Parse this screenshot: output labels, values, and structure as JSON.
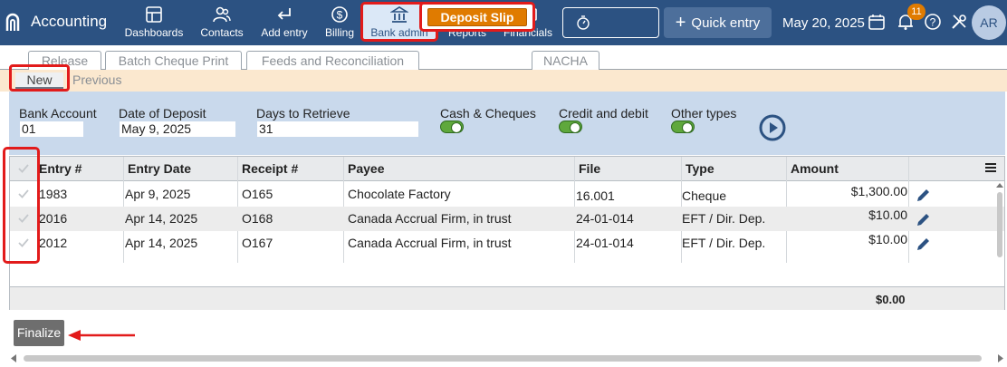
{
  "app": {
    "title": "Accounting"
  },
  "nav": [
    {
      "label": "Dashboards",
      "icon": "dashboard-icon"
    },
    {
      "label": "Contacts",
      "icon": "contacts-icon"
    },
    {
      "label": "Add entry",
      "icon": "return-arrow-icon"
    },
    {
      "label": "Billing",
      "icon": "dollar-icon"
    },
    {
      "label": "Bank admin",
      "icon": "bank-icon"
    },
    {
      "label": "Reports",
      "icon": "bar-chart-icon"
    },
    {
      "label": "Financials",
      "icon": "money-icon"
    }
  ],
  "header": {
    "quick_entry_label": "Quick entry",
    "date": "May 20, 2025",
    "notification_count": "11",
    "avatar_initials": "AR"
  },
  "tabs": [
    "Release",
    "Batch Cheque Print",
    "Feeds and Reconciliation",
    "Deposit Slip",
    "NACHA"
  ],
  "active_tab": "Deposit Slip",
  "subtabs": {
    "new": "New",
    "previous": "Previous"
  },
  "filters": {
    "bank_account_label": "Bank Account",
    "bank_account_value": "01",
    "deposit_date_label": "Date of Deposit",
    "deposit_date_value": "May 9, 2025",
    "days_label": "Days to Retrieve",
    "days_value": "31",
    "toggles": [
      {
        "label": "Cash & Cheques",
        "on": true
      },
      {
        "label": "Credit and debit",
        "on": true
      },
      {
        "label": "Other types",
        "on": true
      }
    ]
  },
  "table": {
    "columns": [
      "Entry #",
      "Entry Date",
      "Receipt #",
      "Payee",
      "File",
      "Type",
      "Amount"
    ],
    "rows": [
      {
        "entry": "1983",
        "date": "Apr 9, 2025",
        "receipt": "O165",
        "payee": "Chocolate Factory",
        "file": "16.001",
        "type": "Cheque",
        "amount": "$1,300.00"
      },
      {
        "entry": "2016",
        "date": "Apr 14, 2025",
        "receipt": "O168",
        "payee": "Canada Accrual Firm, in trust",
        "file": "24-01-014",
        "type": "EFT / Dir. Dep.",
        "amount": "$10.00"
      },
      {
        "entry": "2012",
        "date": "Apr 14, 2025",
        "receipt": "O167",
        "payee": "Canada Accrual Firm, in trust",
        "file": "24-01-014",
        "type": "EFT / Dir. Dep.",
        "amount": "$10.00"
      }
    ],
    "total": "$0.00"
  },
  "actions": {
    "finalize_label": "Finalize"
  },
  "colors": {
    "topbar": "#2c5282",
    "accent": "#e07b00",
    "highlight": "#e21b1b",
    "filter_bg": "#c9d9ec",
    "subtab_bg": "#fbe8cf"
  }
}
